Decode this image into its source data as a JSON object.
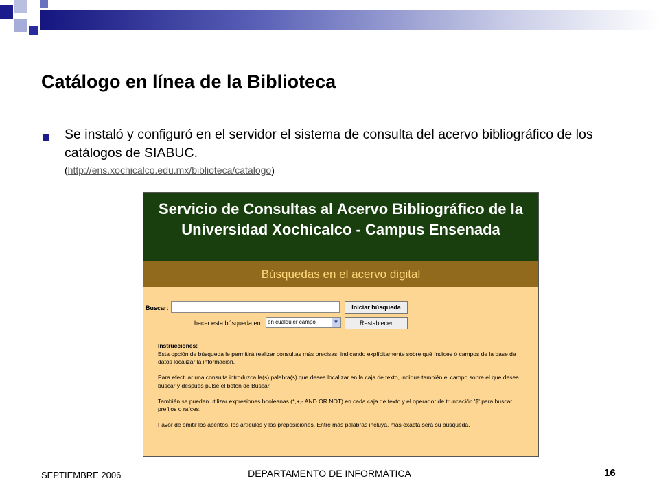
{
  "slide": {
    "title": "Catálogo en línea de la Biblioteca",
    "bullet_text": "Se instaló y configuró en el servidor el sistema de consulta del acervo bibliográfico de los catálogos de SIABUC.",
    "url_open": "(",
    "url": "http://ens.xochicalco.edu.mx/biblioteca/catalogo",
    "url_close": ")"
  },
  "embedded_page": {
    "header_line1": "Servicio de Consultas al Acervo Bibliográfico de la",
    "header_line2": "Universidad Xochicalco - Campus Ensenada",
    "subheader": "Búsquedas en el acervo digital",
    "search": {
      "label": "Buscar:",
      "value": "",
      "button": "Iniciar búsqueda"
    },
    "field": {
      "label": "hacer esta búsqueda en",
      "selected": "en cualquier campo",
      "reset_button": "Restablecer"
    },
    "instructions": {
      "heading": "Instrucciones:",
      "p1": "Esta opción de búsqueda le permitirá realizar consultas más precisas, indicando explícitamente sobre qué índices ó campos de la base de datos localizar la información.",
      "p2": "Para efectuar una consulta introduzca la(s) palabra(s) que desea localizar en la caja de texto, indique también el campo sobre el que desea buscar y después pulse el botón de Buscar.",
      "p3": "También se pueden utilizar expresiones booleanas (*,+,- AND OR NOT) en cada caja de texto y el operador de truncación '$' para buscar prefijos o raíces.",
      "p4": "Favor de omitir los acentos, los artículos y las preposiciones. Entre más palabras incluya, más exacta será su búsqueda."
    },
    "colors": {
      "header_bg": "#193f0f",
      "subheader_bg": "#926a1e",
      "subheader_text": "#ffd77a",
      "body_bg": "#fdd693"
    }
  },
  "footer": {
    "date": "SEPTIEMBRE 2006",
    "department": "DEPARTAMENTO DE INFORMÁTICA",
    "page_number": "16"
  },
  "theme": {
    "accent": "#1c1c8c"
  }
}
